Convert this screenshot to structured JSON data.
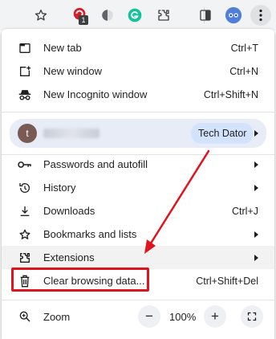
{
  "toolbar": {
    "icons": [
      "star-icon",
      "extension-badge-icon",
      "extension-icon-2",
      "grammarly-icon",
      "puzzle-icon",
      "side-panel-icon",
      "profile-icon",
      "kebab-menu-icon"
    ],
    "badge": "1"
  },
  "menu": {
    "group1": [
      {
        "label": "New tab",
        "shortcut": "Ctrl+T",
        "icon": "new-tab-icon"
      },
      {
        "label": "New window",
        "shortcut": "Ctrl+N",
        "icon": "new-window-icon"
      },
      {
        "label": "New Incognito window",
        "shortcut": "Ctrl+Shift+N",
        "icon": "incognito-icon"
      }
    ],
    "profile": {
      "avatar_letter": "t",
      "chip": "Tech Dator"
    },
    "group2": [
      {
        "label": "Passwords and autofill",
        "icon": "key-icon"
      },
      {
        "label": "History",
        "icon": "history-icon"
      },
      {
        "label": "Downloads",
        "shortcut": "Ctrl+J",
        "icon": "download-icon"
      },
      {
        "label": "Bookmarks and lists",
        "icon": "star-outline-icon"
      },
      {
        "label": "Extensions",
        "icon": "puzzle-icon"
      },
      {
        "label": "Clear browsing data...",
        "shortcut": "Ctrl+Shift+Del",
        "icon": "trash-icon"
      }
    ],
    "zoom": {
      "label": "Zoom",
      "minus": "−",
      "value": "100%",
      "plus": "+"
    }
  },
  "annotation": {
    "color": "#e0141e"
  }
}
